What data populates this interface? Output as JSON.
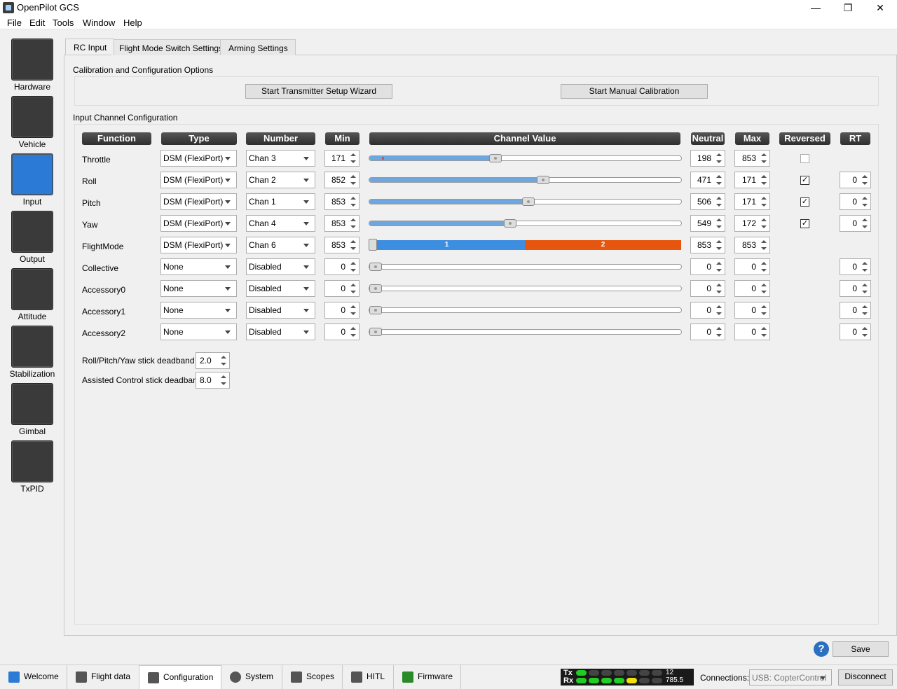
{
  "window": {
    "title": "OpenPilot GCS",
    "min": "—",
    "max": "❐",
    "close": "✕"
  },
  "menu": {
    "file": "File",
    "edit": "Edit",
    "tools": "Tools",
    "window": "Window",
    "help": "Help"
  },
  "sidebar": [
    {
      "label": "Hardware",
      "icon": "chip-icon"
    },
    {
      "label": "Vehicle",
      "icon": "airplane-icon"
    },
    {
      "label": "Input",
      "icon": "transmitter-icon"
    },
    {
      "label": "Output",
      "icon": "motor-icon"
    },
    {
      "label": "Attitude",
      "icon": "level-icon"
    },
    {
      "label": "Stabilization",
      "icon": "gyro-icon"
    },
    {
      "label": "Gimbal",
      "icon": "camera-icon"
    },
    {
      "label": "TxPID",
      "icon": "gauge-icon"
    }
  ],
  "tabs": {
    "rc_input": "RC Input",
    "flight_mode": "Flight Mode Switch Settings",
    "arming": "Arming Settings"
  },
  "calibration": {
    "title": "Calibration and Configuration Options",
    "wizard_button": "Start Transmitter Setup Wizard",
    "manual_button": "Start Manual Calibration"
  },
  "channels_title": "Input Channel Configuration",
  "headers": {
    "function": "Function",
    "type": "Type",
    "number": "Number",
    "min": "Min",
    "channel_value": "Channel Value",
    "neutral": "Neutral",
    "max": "Max",
    "reversed": "Reversed",
    "rt": "RT"
  },
  "rows": [
    {
      "function": "Throttle",
      "type": "DSM (FlexiPort)",
      "number": "Chan 3",
      "min": "171",
      "value": 0.4,
      "marker": 0.04,
      "neutral": "198",
      "max": "853",
      "reversed": "",
      "rt": ""
    },
    {
      "function": "Roll",
      "type": "DSM (FlexiPort)",
      "number": "Chan 2",
      "min": "852",
      "value": 0.56,
      "marker": 0.55,
      "neutral": "471",
      "max": "171",
      "reversed": "✓",
      "rt": "0"
    },
    {
      "function": "Pitch",
      "type": "DSM (FlexiPort)",
      "number": "Chan 1",
      "min": "853",
      "value": 0.51,
      "marker": 0.5,
      "neutral": "506",
      "max": "171",
      "reversed": "✓",
      "rt": "0"
    },
    {
      "function": "Yaw",
      "type": "DSM (FlexiPort)",
      "number": "Chan 4",
      "min": "853",
      "value": 0.45,
      "marker": 0.44,
      "neutral": "549",
      "max": "172",
      "reversed": "✓",
      "rt": "0"
    },
    {
      "function": "FlightMode",
      "type": "DSM (FlexiPort)",
      "number": "Chan 6",
      "min": "853",
      "neutral": "853",
      "max": "853",
      "reversed": null,
      "rt": null,
      "segment_1": "1",
      "segment_2": "2"
    },
    {
      "function": "Collective",
      "type": "None",
      "number": "Disabled",
      "min": "0",
      "value": 0.0,
      "neutral": "0",
      "max": "0",
      "reversed": null,
      "rt": "0"
    },
    {
      "function": "Accessory0",
      "type": "None",
      "number": "Disabled",
      "min": "0",
      "value": 0.0,
      "neutral": "0",
      "max": "0",
      "reversed": null,
      "rt": "0"
    },
    {
      "function": "Accessory1",
      "type": "None",
      "number": "Disabled",
      "min": "0",
      "value": 0.0,
      "neutral": "0",
      "max": "0",
      "reversed": null,
      "rt": "0"
    },
    {
      "function": "Accessory2",
      "type": "None",
      "number": "Disabled",
      "min": "0",
      "value": 0.0,
      "neutral": "0",
      "max": "0",
      "reversed": null,
      "rt": "0"
    }
  ],
  "deadband": {
    "rpy_label": "Roll/Pitch/Yaw stick deadband",
    "rpy_value": "2.0",
    "assisted_label": "Assisted Control stick deadband",
    "assisted_value": "8.0"
  },
  "save_button": "Save",
  "bottom_tabs": [
    {
      "label": "Welcome",
      "icon": "welcome-icon"
    },
    {
      "label": "Flight data",
      "icon": "flight-data-icon"
    },
    {
      "label": "Configuration",
      "icon": "wrench-icon"
    },
    {
      "label": "System",
      "icon": "gear-icon"
    },
    {
      "label": "Scopes",
      "icon": "scope-icon"
    },
    {
      "label": "HITL",
      "icon": "gamepad-icon"
    },
    {
      "label": "Firmware",
      "icon": "chip-icon"
    }
  ],
  "telemetry": {
    "tx": "Tx",
    "rx": "Rx",
    "tx_value": "12",
    "rx_value": "785.5",
    "rx_level": 5,
    "tx_level": 0
  },
  "connections": {
    "label": "Connections:",
    "device": "USB: CopterControl",
    "disconnect": "Disconnect"
  },
  "colors": {
    "accent_blue": "#3d8ee0",
    "flightmode_orange": "#e6560f",
    "led_green": "#22cc22",
    "led_yellow": "#f2e00a"
  }
}
